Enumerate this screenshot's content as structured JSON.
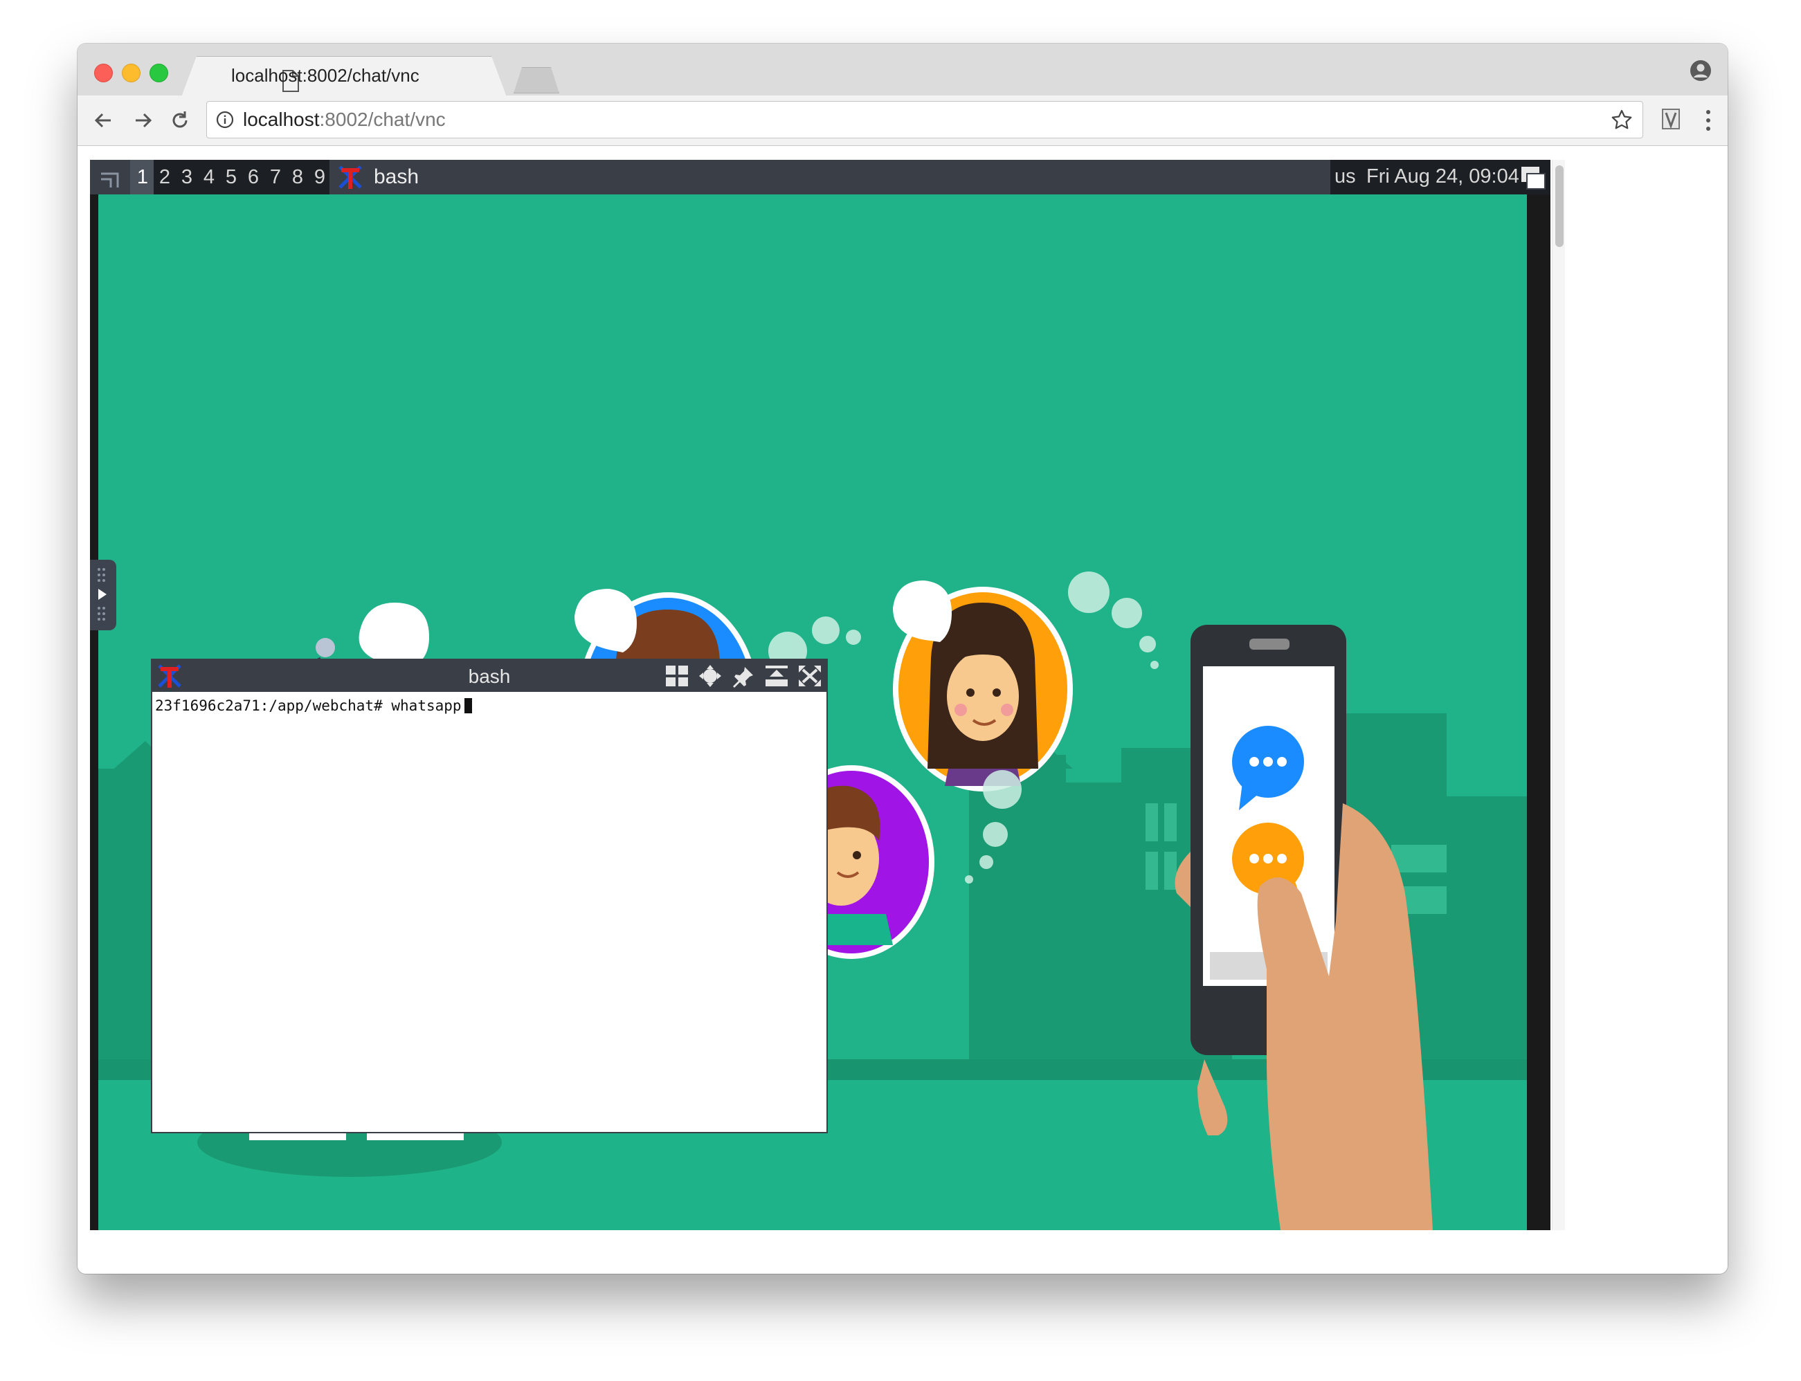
{
  "browser": {
    "tab": {
      "title": "localhost:8002/chat/vnc",
      "close_glyph": "×"
    },
    "url": {
      "host": "localhost",
      "path": ":8002/chat/vnc"
    }
  },
  "wm": {
    "workspaces": [
      "1",
      "2",
      "3",
      "4",
      "5",
      "6",
      "7",
      "8",
      "9"
    ],
    "current_workspace": "1",
    "focused_title": "bash",
    "layout": "us",
    "clock": "Fri Aug 24, 09:04"
  },
  "terminal": {
    "title": "bash",
    "prompt": "23f1696c2a71:/app/webchat#",
    "command": "whatsapp"
  },
  "colors": {
    "desktop_teal": "#20b38a",
    "bubble_blue": "#1a8cff",
    "bubble_orange": "#ff9f0a",
    "bubble_purple": "#a015e6",
    "wm_bar": "#3a3f47"
  }
}
